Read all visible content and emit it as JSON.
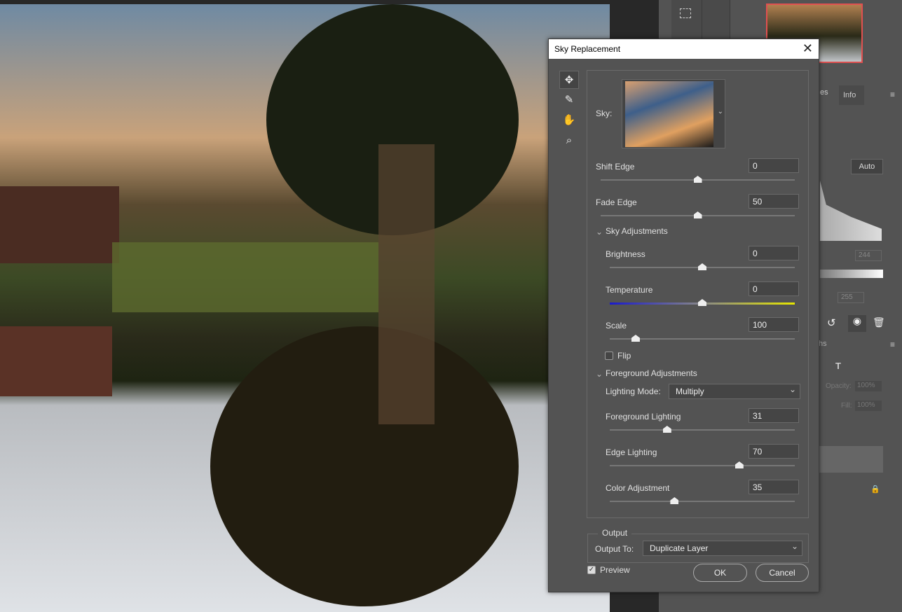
{
  "dialog": {
    "title": "Sky Replacement",
    "close_icon": "close-icon",
    "tools": [
      "move-icon",
      "brush-icon",
      "hand-icon",
      "zoom-icon"
    ],
    "sky_label": "Sky:",
    "shift_edge": {
      "label": "Shift Edge",
      "value": "0",
      "slider": 0.5
    },
    "fade_edge": {
      "label": "Fade Edge",
      "value": "50",
      "slider": 0.5
    },
    "sky_adjustments": {
      "label": "Sky Adjustments",
      "brightness": {
        "label": "Brightness",
        "value": "0",
        "slider": 0.5
      },
      "temperature": {
        "label": "Temperature",
        "value": "0",
        "slider": 0.5
      },
      "scale": {
        "label": "Scale",
        "value": "100",
        "slider": 0.14
      },
      "flip": {
        "label": "Flip",
        "checked": false
      }
    },
    "foreground_adjustments": {
      "label": "Foreground Adjustments",
      "lighting_mode_label": "Lighting Mode:",
      "lighting_mode": "Multiply",
      "foreground_lighting": {
        "label": "Foreground Lighting",
        "value": "31",
        "slider": 0.31
      },
      "edge_lighting": {
        "label": "Edge Lighting",
        "value": "70",
        "slider": 0.7
      },
      "color_adjustment": {
        "label": "Color Adjustment",
        "value": "35",
        "slider": 0.35
      }
    },
    "output": {
      "label": "Output",
      "output_to_label": "Output To:",
      "output_to": "Duplicate Layer"
    },
    "preview": {
      "label": "Preview",
      "checked": true
    },
    "ok": "OK",
    "cancel": "Cancel"
  },
  "right_panel": {
    "tab_partial": "es",
    "tab_info": "Info",
    "auto": "Auto",
    "input_value": "244",
    "output_value": "255",
    "paths_tab_partial": "ths",
    "opacity_label": "Opacity:",
    "opacity": "100%",
    "fill_label": "Fill:",
    "fill": "100%"
  },
  "colors": {
    "accent_red": "#e05050",
    "temp_start": "#1a1acc",
    "temp_end": "#e6e600"
  }
}
